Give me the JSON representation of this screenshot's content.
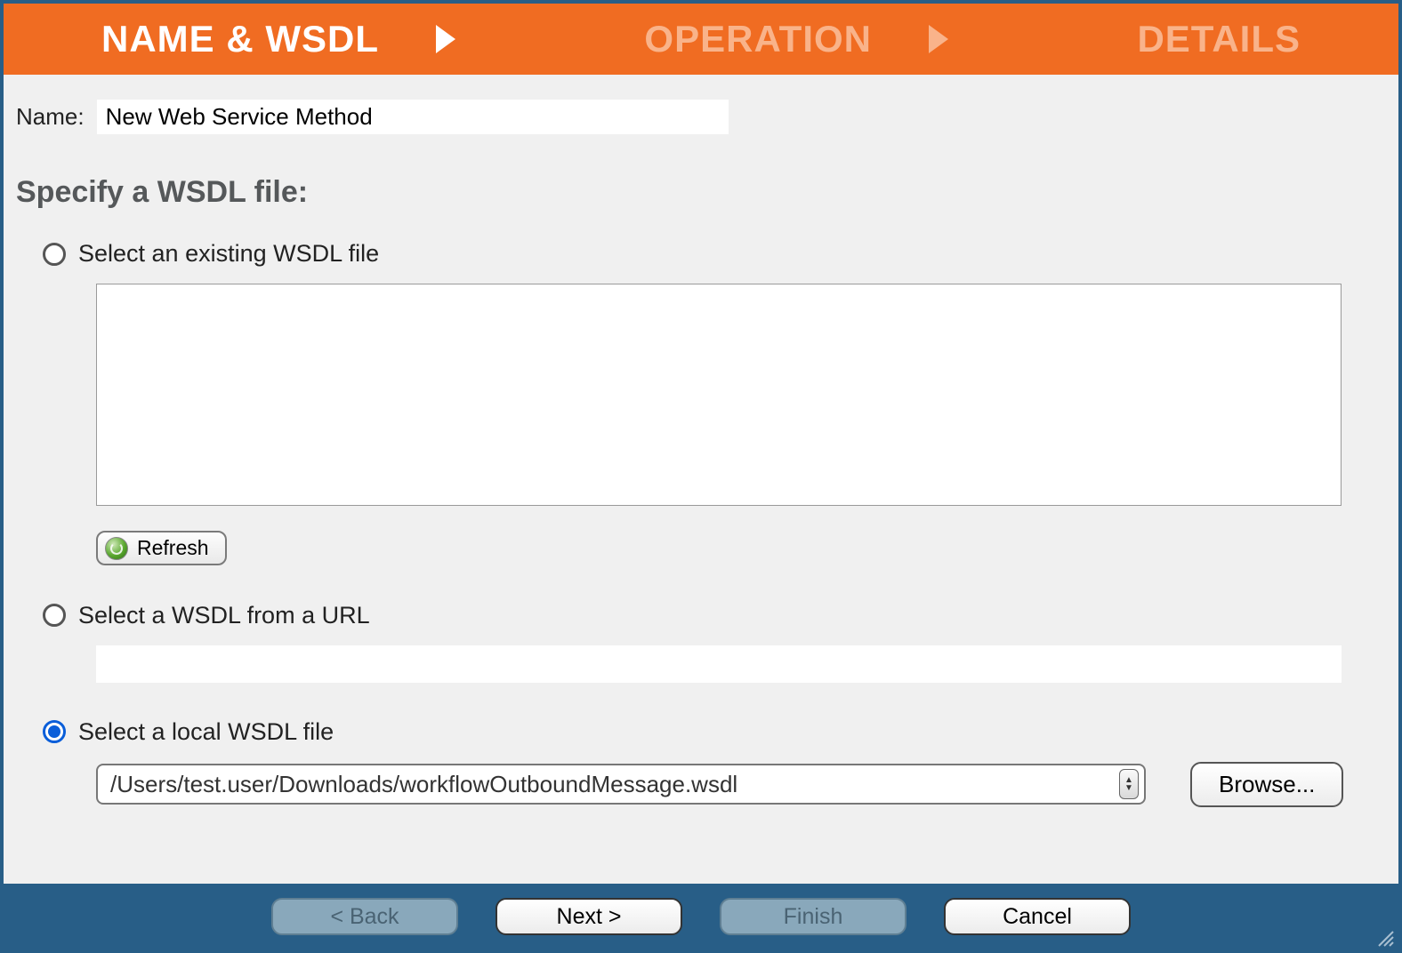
{
  "steps": {
    "current": "NAME & WSDL",
    "step2": "OPERATION",
    "step3": "DETAILS"
  },
  "name": {
    "label": "Name:",
    "value": "New Web Service Method"
  },
  "section_heading": "Specify a WSDL file:",
  "options": {
    "existing": {
      "label": "Select an existing WSDL file",
      "selected": false
    },
    "url": {
      "label": "Select a WSDL from a URL",
      "selected": false,
      "value": ""
    },
    "local": {
      "label": "Select a local WSDL file",
      "selected": true,
      "value": "/Users/test.user/Downloads/workflowOutboundMessage.wsdl"
    }
  },
  "buttons": {
    "refresh": "Refresh",
    "browse": "Browse...",
    "back": "< Back",
    "next": "Next >",
    "finish": "Finish",
    "cancel": "Cancel"
  }
}
